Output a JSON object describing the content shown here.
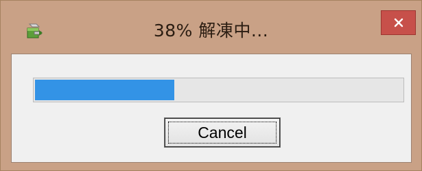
{
  "window": {
    "title": "38% 解凍中..."
  },
  "titlebar": {
    "app_icon": "archive-extract-icon",
    "close_icon": "close-icon",
    "close_color": "#c7504a"
  },
  "progress": {
    "percent": 38,
    "fill_color": "#3393e6"
  },
  "buttons": {
    "cancel_label": "Cancel"
  }
}
